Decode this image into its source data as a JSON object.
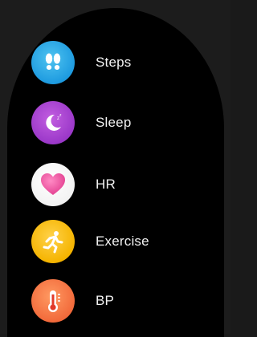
{
  "menu": {
    "items": [
      {
        "id": "steps",
        "label": "Steps",
        "icon": "footprints-icon",
        "color": "#1e9be0"
      },
      {
        "id": "sleep",
        "label": "Sleep",
        "icon": "moon-icon",
        "color": "#9b38c9"
      },
      {
        "id": "hr",
        "label": "HR",
        "icon": "heart-icon",
        "color": "#f060a8"
      },
      {
        "id": "exercise",
        "label": "Exercise",
        "icon": "runner-icon",
        "color": "#f5b400"
      },
      {
        "id": "bp",
        "label": "BP",
        "icon": "thermometer-icon",
        "color": "#f26a3b"
      }
    ]
  }
}
